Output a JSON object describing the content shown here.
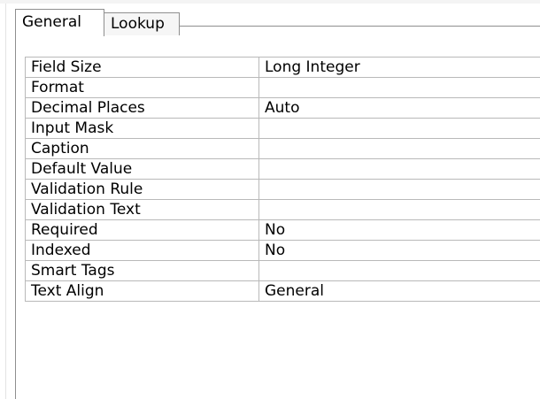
{
  "tabs": [
    {
      "label": "General",
      "selected": true
    },
    {
      "label": "Lookup",
      "selected": false
    }
  ],
  "properties": [
    {
      "label": "Field Size",
      "value": "Long Integer"
    },
    {
      "label": "Format",
      "value": ""
    },
    {
      "label": "Decimal Places",
      "value": "Auto"
    },
    {
      "label": "Input Mask",
      "value": ""
    },
    {
      "label": "Caption",
      "value": ""
    },
    {
      "label": "Default Value",
      "value": ""
    },
    {
      "label": "Validation Rule",
      "value": ""
    },
    {
      "label": "Validation Text",
      "value": ""
    },
    {
      "label": "Required",
      "value": "No"
    },
    {
      "label": "Indexed",
      "value": "No"
    },
    {
      "label": "Smart Tags",
      "value": ""
    },
    {
      "label": "Text Align",
      "value": "General"
    }
  ]
}
